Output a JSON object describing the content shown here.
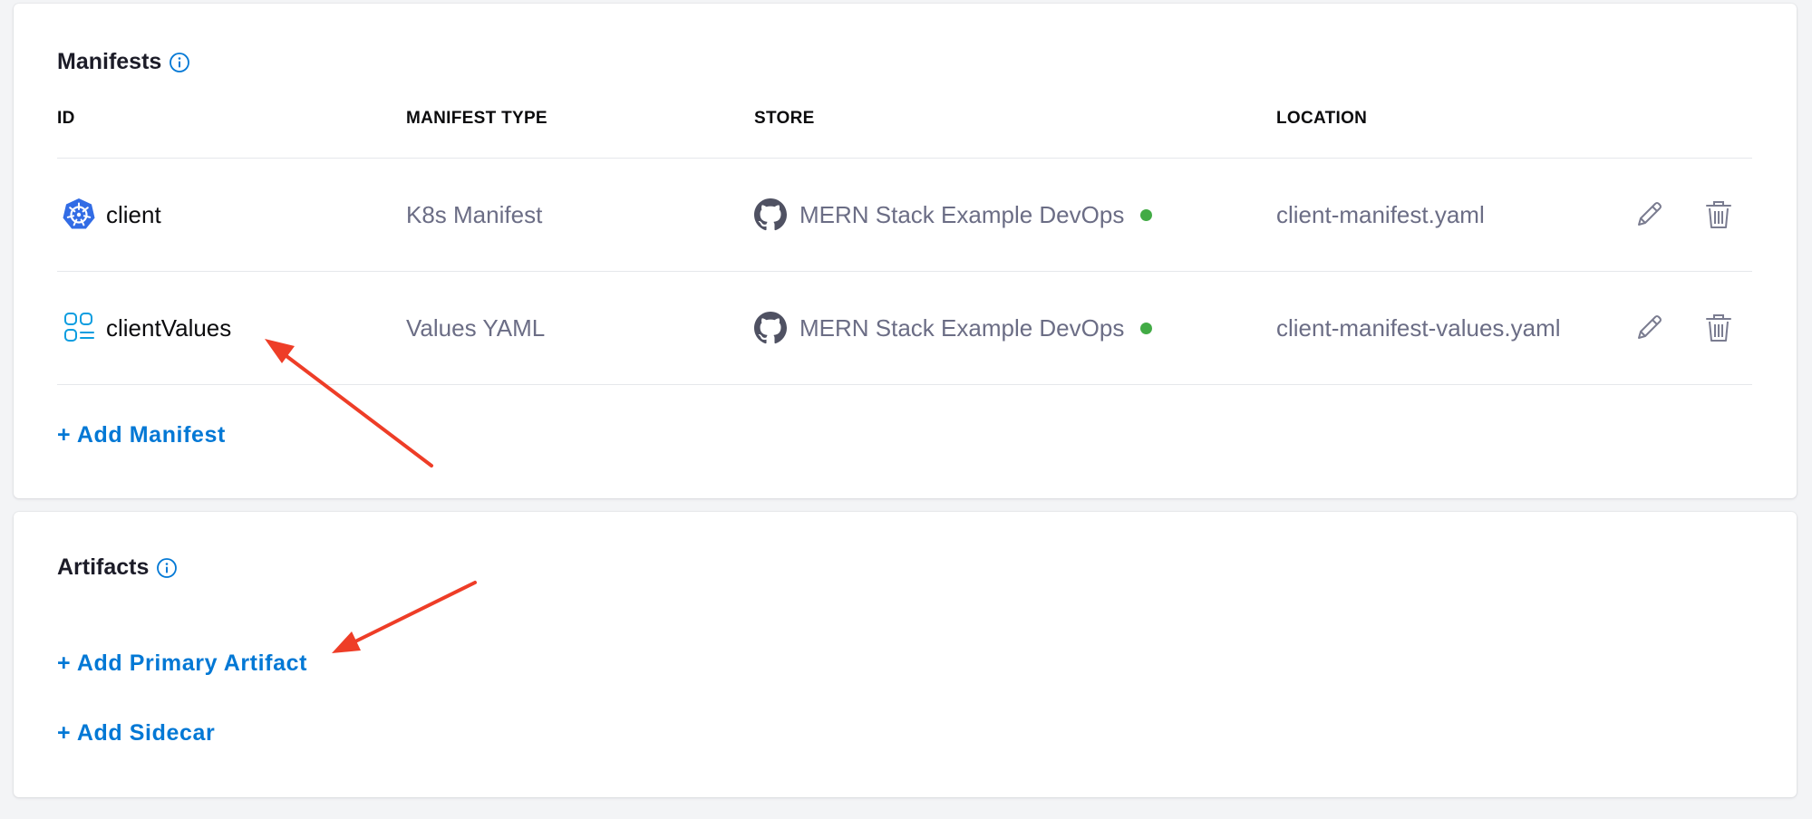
{
  "colors": {
    "link": "#0278d5",
    "status_ok": "#42ab45",
    "kubernetes_blue": "#326ce5",
    "values_icon": "#0b9de0",
    "annotation_arrow": "#ee3d27"
  },
  "manifests": {
    "title": "Manifests",
    "columns": {
      "id": "ID",
      "manifest_type": "MANIFEST TYPE",
      "store": "STORE",
      "location": "LOCATION"
    },
    "rows": [
      {
        "id": "client",
        "id_icon": "kubernetes-icon",
        "manifest_type": "K8s Manifest",
        "store": "MERN Stack Example DevOps",
        "store_icon": "github-icon",
        "status": "connected",
        "location": "client-manifest.yaml"
      },
      {
        "id": "clientValues",
        "id_icon": "values-yaml-icon",
        "manifest_type": "Values YAML",
        "store": "MERN Stack Example DevOps",
        "store_icon": "github-icon",
        "status": "connected",
        "location": "client-manifest-values.yaml"
      }
    ],
    "add_label": "+ Add Manifest"
  },
  "artifacts": {
    "title": "Artifacts",
    "add_primary_label": "+ Add Primary Artifact",
    "add_sidecar_label": "+ Add Sidecar"
  }
}
